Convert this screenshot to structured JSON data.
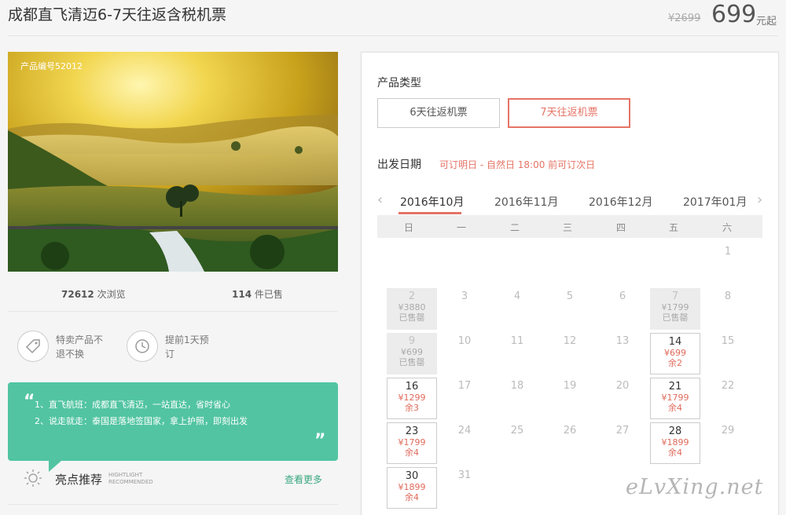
{
  "header": {
    "title": "成都直飞清迈6-7天往返含税机票",
    "original_price": "¥2699",
    "price": "699",
    "price_unit": "元起"
  },
  "photo": {
    "product_no": "产品编号52012"
  },
  "stats": {
    "views_count": "72612",
    "views_label": "次浏览",
    "sold_count": "114",
    "sold_label": "件已售"
  },
  "features": [
    {
      "icon": "tag-icon",
      "text": "特卖产品不退不换"
    },
    {
      "icon": "clock-history-icon",
      "text": "提前1天预订"
    }
  ],
  "promo": {
    "quote_open": "“",
    "quote_close": "”",
    "lines": [
      "1、直飞航班：成都直飞清迈，一站直达，省时省心",
      "2、说走就走：泰国是落地签国家，拿上护照，即刻出发"
    ],
    "color": "#52c4a2"
  },
  "highlight": {
    "title": "亮点推荐",
    "subtitle_line1": "HIGHTLIGHT",
    "subtitle_line2": "RECOMMENDED",
    "see_more": "查看更多"
  },
  "panel": {
    "product_type_label": "产品类型",
    "types": [
      {
        "label": "6天往返机票",
        "selected": false
      },
      {
        "label": "7天往返机票",
        "selected": true
      }
    ],
    "date_label": "出发日期",
    "date_note": "可订明日 - 自然日 18:00 前可订次日",
    "accent": "#e57466",
    "months": [
      "2016年10月",
      "2016年11月",
      "2016年12月",
      "2017年01月"
    ],
    "selected_month": "2016年10月",
    "prev_arrow": "‹",
    "next_arrow": "›",
    "weekdays": [
      "日",
      "一",
      "二",
      "三",
      "四",
      "五",
      "六"
    ],
    "days": [
      {
        "day": "1",
        "col": 6,
        "row": 0,
        "status": "plain"
      },
      {
        "day": "2",
        "col": 0,
        "row": 1,
        "status": "soldout",
        "price": "¥3880",
        "note": "已售罄"
      },
      {
        "day": "3",
        "col": 1,
        "row": 1,
        "status": "plain"
      },
      {
        "day": "4",
        "col": 2,
        "row": 1,
        "status": "plain"
      },
      {
        "day": "5",
        "col": 3,
        "row": 1,
        "status": "plain"
      },
      {
        "day": "6",
        "col": 4,
        "row": 1,
        "status": "plain"
      },
      {
        "day": "7",
        "col": 5,
        "row": 1,
        "status": "soldout",
        "price": "¥1799",
        "note": "已售罄"
      },
      {
        "day": "8",
        "col": 6,
        "row": 1,
        "status": "plain"
      },
      {
        "day": "9",
        "col": 0,
        "row": 2,
        "status": "soldout",
        "price": "¥699",
        "note": "已售罄"
      },
      {
        "day": "10",
        "col": 1,
        "row": 2,
        "status": "plain"
      },
      {
        "day": "11",
        "col": 2,
        "row": 2,
        "status": "plain"
      },
      {
        "day": "12",
        "col": 3,
        "row": 2,
        "status": "plain"
      },
      {
        "day": "13",
        "col": 4,
        "row": 2,
        "status": "plain"
      },
      {
        "day": "14",
        "col": 5,
        "row": 2,
        "status": "avail",
        "price": "¥699",
        "note": "余2"
      },
      {
        "day": "15",
        "col": 6,
        "row": 2,
        "status": "plain"
      },
      {
        "day": "16",
        "col": 0,
        "row": 3,
        "status": "avail",
        "price": "¥1299",
        "note": "余3"
      },
      {
        "day": "17",
        "col": 1,
        "row": 3,
        "status": "plain"
      },
      {
        "day": "18",
        "col": 2,
        "row": 3,
        "status": "plain"
      },
      {
        "day": "19",
        "col": 3,
        "row": 3,
        "status": "plain"
      },
      {
        "day": "20",
        "col": 4,
        "row": 3,
        "status": "plain"
      },
      {
        "day": "21",
        "col": 5,
        "row": 3,
        "status": "avail",
        "price": "¥1799",
        "note": "余4"
      },
      {
        "day": "22",
        "col": 6,
        "row": 3,
        "status": "plain"
      },
      {
        "day": "23",
        "col": 0,
        "row": 4,
        "status": "avail",
        "price": "¥1799",
        "note": "余4"
      },
      {
        "day": "24",
        "col": 1,
        "row": 4,
        "status": "plain"
      },
      {
        "day": "25",
        "col": 2,
        "row": 4,
        "status": "plain"
      },
      {
        "day": "26",
        "col": 3,
        "row": 4,
        "status": "plain"
      },
      {
        "day": "27",
        "col": 4,
        "row": 4,
        "status": "plain"
      },
      {
        "day": "28",
        "col": 5,
        "row": 4,
        "status": "avail",
        "price": "¥1899",
        "note": "余4"
      },
      {
        "day": "29",
        "col": 6,
        "row": 4,
        "status": "plain"
      },
      {
        "day": "30",
        "col": 0,
        "row": 5,
        "status": "avail",
        "price": "¥1899",
        "note": "余4"
      },
      {
        "day": "31",
        "col": 1,
        "row": 5,
        "status": "plain"
      }
    ]
  },
  "watermark": "eLvXing.net"
}
